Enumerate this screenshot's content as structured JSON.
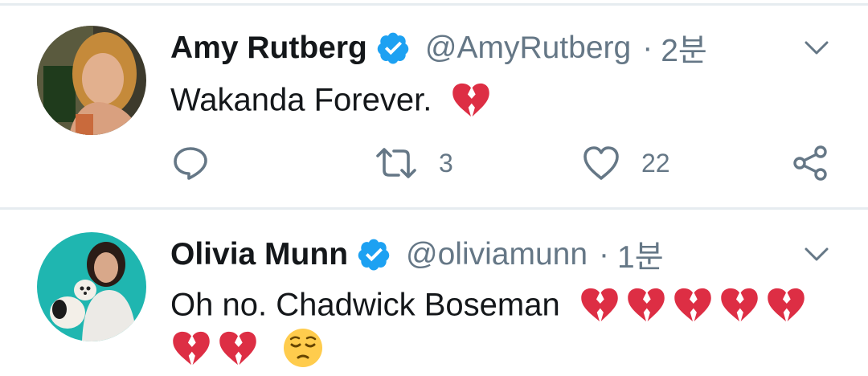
{
  "tweets": [
    {
      "name": "Amy Rutberg",
      "handle": "@AmyRutberg",
      "separator": "·",
      "time": "2분",
      "text": "Wakanda Forever.",
      "emojis": [
        "broken-heart"
      ],
      "actions": {
        "reply_count": "",
        "retweet_count": "3",
        "like_count": "22"
      },
      "verified": true
    },
    {
      "name": "Olivia Munn",
      "handle": "@oliviamunn",
      "separator": "·",
      "time": "1분",
      "text": "Oh no. Chadwick Boseman",
      "emojis": [
        "broken-heart",
        "broken-heart",
        "broken-heart",
        "broken-heart",
        "broken-heart",
        "broken-heart",
        "broken-heart",
        "pensive-face"
      ],
      "verified": true
    }
  ],
  "colors": {
    "verified": "#1da1f2",
    "muted": "#657786",
    "divider": "#e6ecf0",
    "broken_heart": "#dd2e44"
  }
}
